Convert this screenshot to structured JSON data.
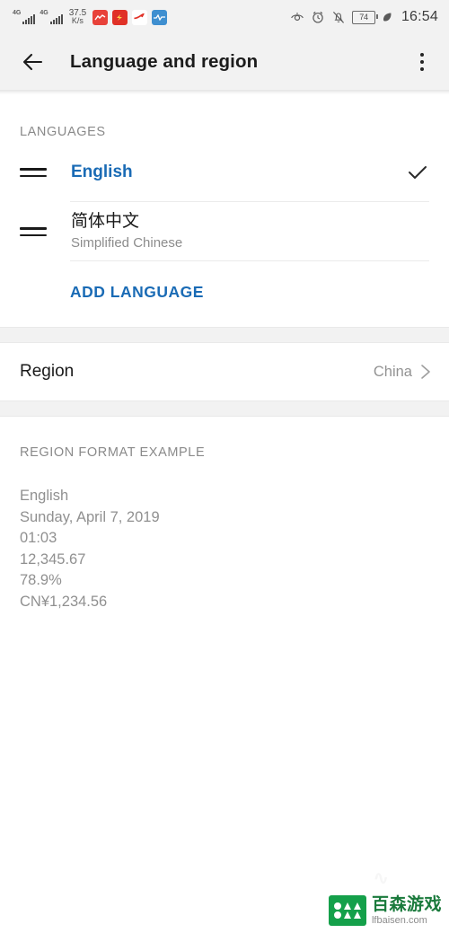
{
  "status_bar": {
    "signal_1": {
      "network": "4G",
      "icon": "signal-bars-icon"
    },
    "signal_2": {
      "network": "4G",
      "icon": "signal-bars-icon"
    },
    "net_speed_value": "37.5",
    "net_speed_unit": "K/s",
    "notification_icons": [
      "app-notification-red-icon",
      "app-notification-orange-icon",
      "app-notification-arrow-icon",
      "app-notification-blue-icon"
    ],
    "right_icons": [
      "eye-comfort-icon",
      "alarm-clock-icon",
      "mute-bell-icon",
      "power-saving-leaf-icon"
    ],
    "battery_level": "74",
    "time": "16:54"
  },
  "toolbar": {
    "back_icon": "back-arrow-icon",
    "title": "Language and region",
    "overflow_icon": "overflow-menu-icon"
  },
  "languages_section": {
    "header": "LANGUAGES",
    "items": [
      {
        "primary": "English",
        "secondary": "",
        "selected": true,
        "drag_icon": "drag-handle-icon",
        "check_icon": "checkmark-icon"
      },
      {
        "primary": "简体中文",
        "secondary": "Simplified Chinese",
        "selected": false,
        "drag_icon": "drag-handle-icon",
        "check_icon": ""
      }
    ],
    "add_language_label": "ADD LANGUAGE"
  },
  "region_section": {
    "label": "Region",
    "value": "China",
    "chevron_icon": "chevron-right-icon"
  },
  "format_section": {
    "header": "REGION FORMAT EXAMPLE",
    "lines": [
      "English",
      "Sunday, April 7, 2019",
      "01:03",
      "12,345.67",
      "78.9%",
      "CN¥1,234.56"
    ]
  },
  "watermark": {
    "brand_cn": "百森游戏",
    "url": "lfbaisen.com",
    "ghost": "∿"
  },
  "colors": {
    "accent_blue": "#1a6bb5",
    "text_primary": "#1a1a1a",
    "text_secondary": "#909090",
    "status_bg": "#f2f2f2",
    "watermark_green": "#14a04a"
  }
}
